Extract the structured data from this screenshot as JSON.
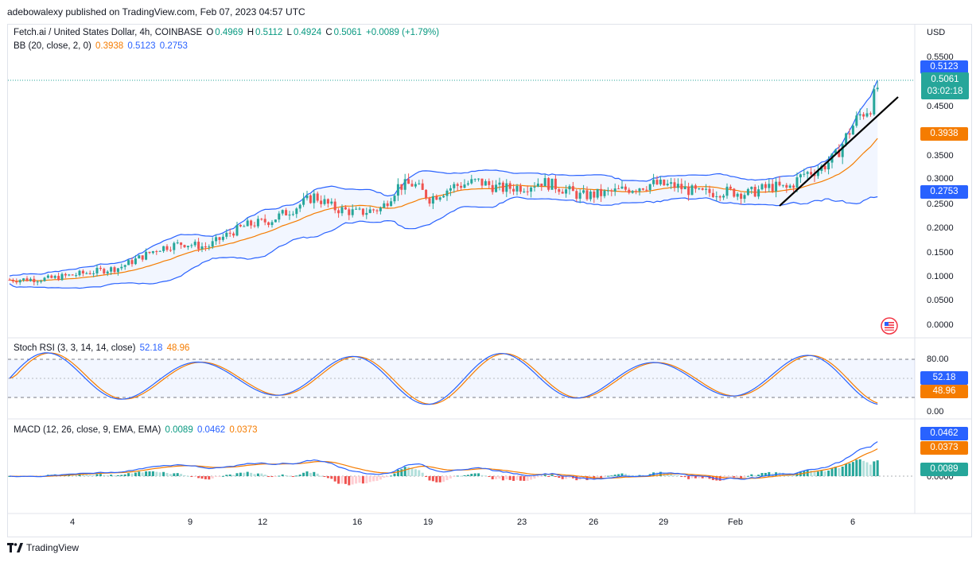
{
  "publisher_line": "adebowalexy published on TradingView.com, Feb 07, 2023 04:57 UTC",
  "legend": {
    "symbol": "Fetch.ai / United States Dollar, 4h, COINBASE",
    "open_label": "O",
    "open": "0.4969",
    "high_label": "H",
    "high": "0.5112",
    "low_label": "L",
    "low": "0.4924",
    "close_label": "C",
    "close": "0.5061",
    "change": "+0.0089 (+1.79%)",
    "bb_label": "BB (20, close, 2, 0)",
    "bb_basis": "0.3938",
    "bb_upper": "0.5123",
    "bb_lower": "0.2753",
    "stoch_label": "Stoch RSI (3, 3, 14, 14, close)",
    "stoch_k": "52.18",
    "stoch_d": "48.96",
    "macd_label": "MACD (12, 26, close, 9, EMA, EMA)",
    "macd_hist": "0.0089",
    "macd_line": "0.0462",
    "macd_signal": "0.0373"
  },
  "price_axis": {
    "currency": "USD",
    "ticks": [
      "0.5500",
      "0.4500",
      "0.3500",
      "0.3000",
      "0.2500",
      "0.2000",
      "0.1500",
      "0.1000",
      "0.0500",
      "0.0000"
    ],
    "upper_tag": "0.5123",
    "current_price": "0.5061",
    "countdown": "03:02:18",
    "basis_tag": "0.3938",
    "lower_tag": "0.2753"
  },
  "stoch_axis": {
    "ticks": [
      "80.00",
      "0.00"
    ],
    "k_tag": "52.18",
    "d_tag": "48.96"
  },
  "macd_axis": {
    "macd_tag": "0.0462",
    "signal_tag": "0.0373",
    "hist_tag": "0.0089",
    "zero_tick": "0.0000"
  },
  "time_axis": [
    "4",
    "9",
    "12",
    "16",
    "19",
    "23",
    "26",
    "29",
    "Feb",
    "6"
  ],
  "footer": {
    "brand": "TradingView"
  },
  "colors": {
    "up": "#26a69a",
    "down": "#ef5350",
    "bb_band": "#2962ff",
    "bb_basis": "#f57c00",
    "stoch_k": "#2962ff",
    "stoch_d": "#f57c00",
    "macd_line": "#2962ff",
    "signal_line": "#f57c00",
    "trendline": "#000000"
  },
  "icons": [
    "tradingview-logo-icon",
    "us-flag-icon"
  ]
}
